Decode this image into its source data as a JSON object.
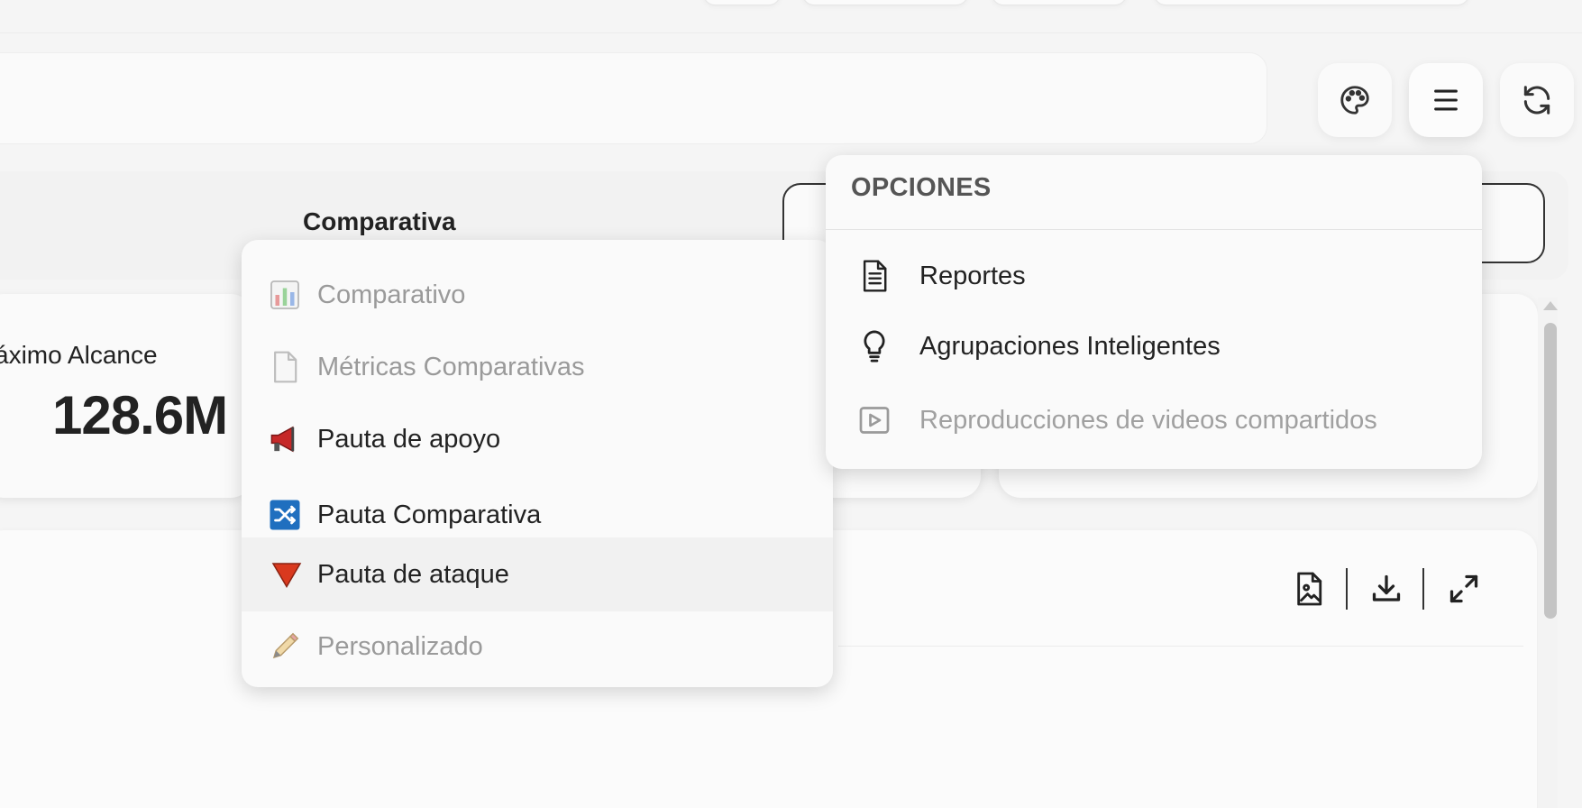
{
  "header": {
    "buttons": [
      {
        "name": "palette-button",
        "icon": "palette-icon"
      },
      {
        "name": "menu-button",
        "icon": "hamburger-icon"
      },
      {
        "name": "refresh-button",
        "icon": "refresh-icon"
      }
    ]
  },
  "filter": {
    "comparativa_label": "Comparativa"
  },
  "metric": {
    "title": "áximo Alcance",
    "value": "128.6M"
  },
  "comparativa_menu": {
    "items": [
      {
        "label": "Comparativo",
        "icon": "bar-chart-icon",
        "disabled": true
      },
      {
        "label": "Métricas Comparativas",
        "icon": "document-icon",
        "disabled": true
      },
      {
        "label": "Pauta de apoyo",
        "icon": "megaphone-icon",
        "disabled": false
      },
      {
        "label": "Pauta Comparativa",
        "icon": "shuffle-icon",
        "disabled": false
      },
      {
        "label": "Pauta de ataque",
        "icon": "red-triangle-icon",
        "disabled": false,
        "hovered": true
      },
      {
        "label": "Personalizado",
        "icon": "pencil-icon",
        "disabled": true
      }
    ]
  },
  "options_menu": {
    "header": "OPCIONES",
    "items": [
      {
        "label": "Reportes",
        "icon": "report-icon",
        "disabled": false
      },
      {
        "label": "Agrupaciones Inteligentes",
        "icon": "lightbulb-icon",
        "disabled": false
      },
      {
        "label": "Reproducciones de videos compartidos",
        "icon": "video-icon",
        "disabled": true
      }
    ]
  },
  "chart_toolbar": {
    "tools": [
      "image-file-icon",
      "download-icon",
      "expand-icon"
    ]
  },
  "colors": {
    "accent_blue": "#1f6fbf",
    "attack_red": "#d9391e",
    "megaphone_red": "#c62828"
  }
}
